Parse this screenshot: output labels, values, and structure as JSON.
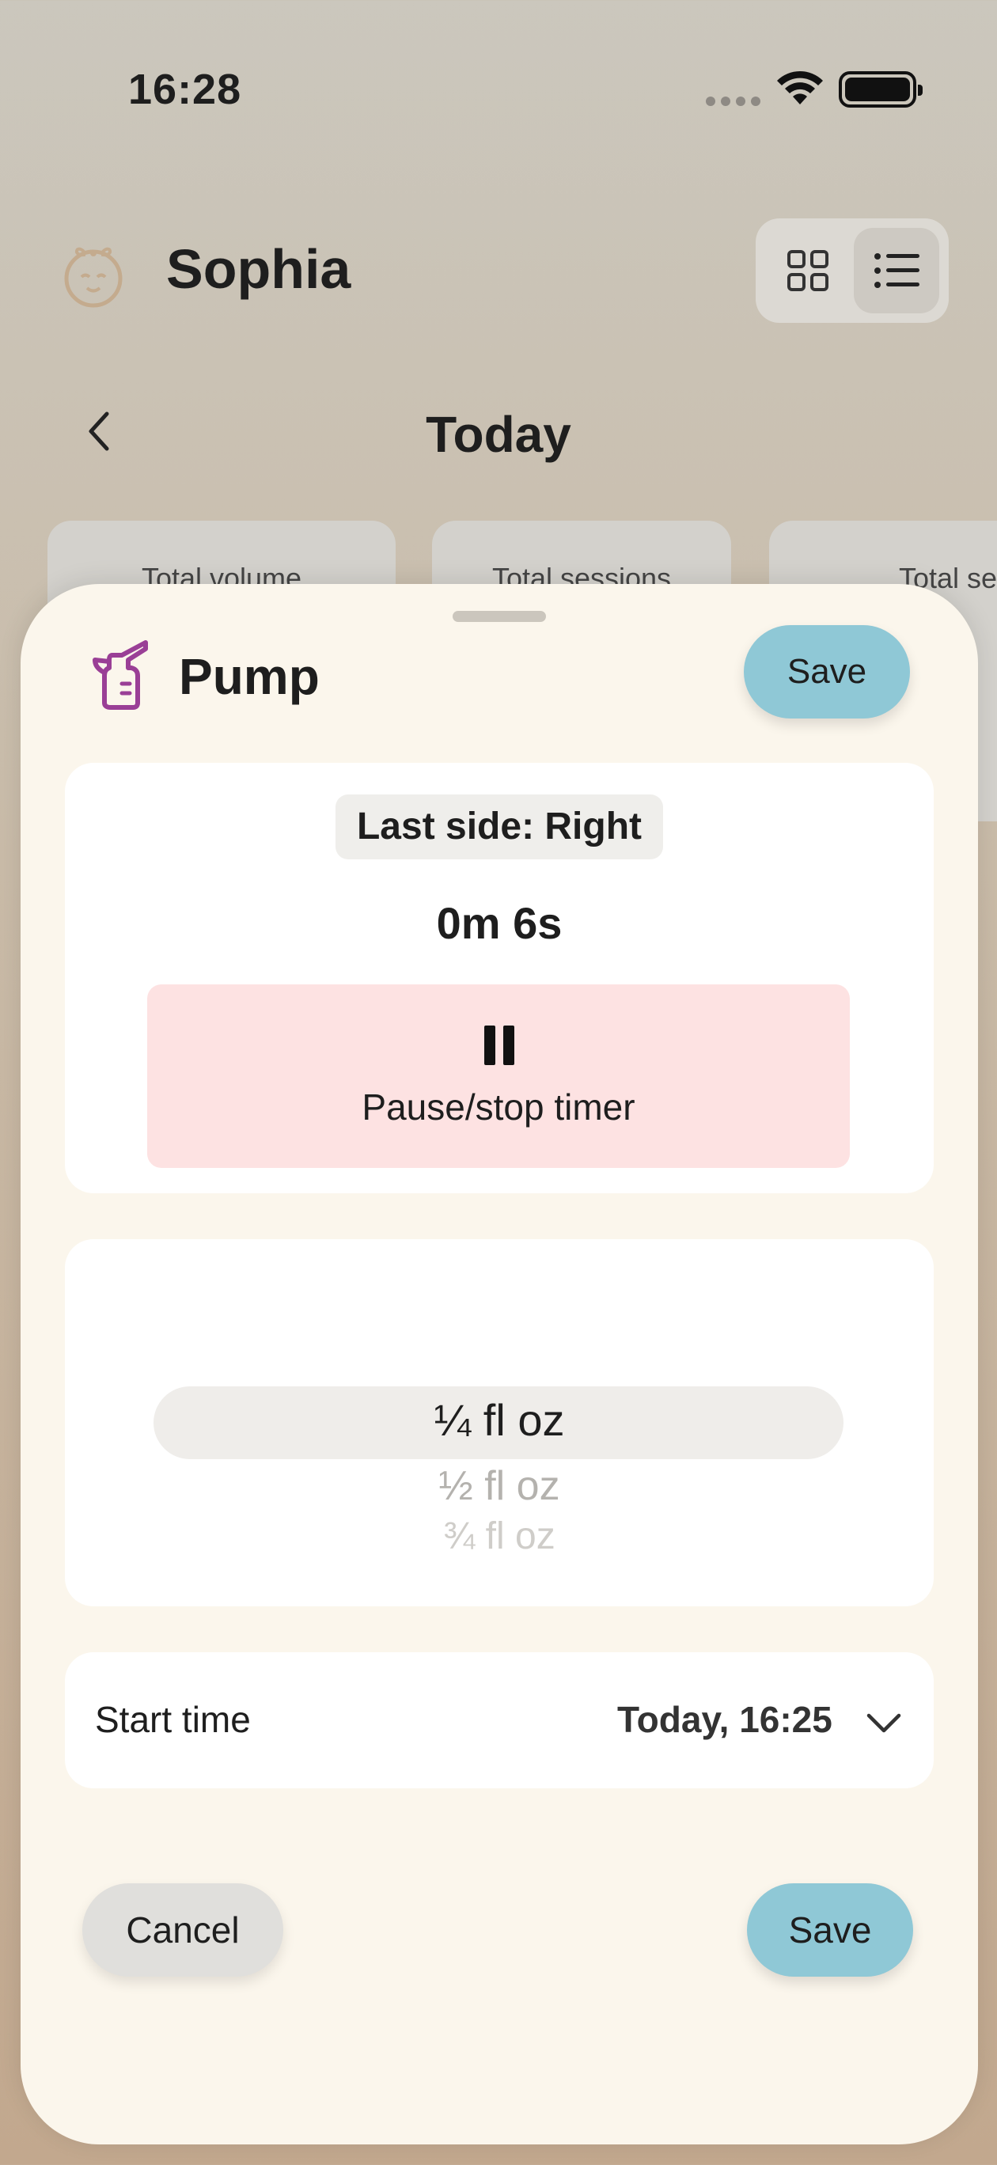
{
  "status_bar": {
    "time": "16:28"
  },
  "header": {
    "profile_name": "Sophia"
  },
  "nav": {
    "title": "Today"
  },
  "stat_cards": [
    {
      "label": "Total volume"
    },
    {
      "label": "Total sessions"
    },
    {
      "label": "Total se"
    }
  ],
  "sheet": {
    "title": "Pump",
    "save_top_label": "Save",
    "last_side": "Last side: Right",
    "elapsed": "0m 6s",
    "pause_label": "Pause/stop timer",
    "volume_options": [
      "¼ fl oz",
      "½ fl oz",
      "¾ fl oz"
    ],
    "selected_volume": "¼ fl oz",
    "start_time_label": "Start time",
    "start_time_value": "Today, 16:25",
    "cancel_label": "Cancel",
    "save_bottom_label": "Save"
  },
  "colors": {
    "save_button": "#8fc8d6",
    "pause_button": "#fde2e2",
    "pump_icon": "#9a3f96",
    "sheet_background": "#fbf6ec"
  }
}
